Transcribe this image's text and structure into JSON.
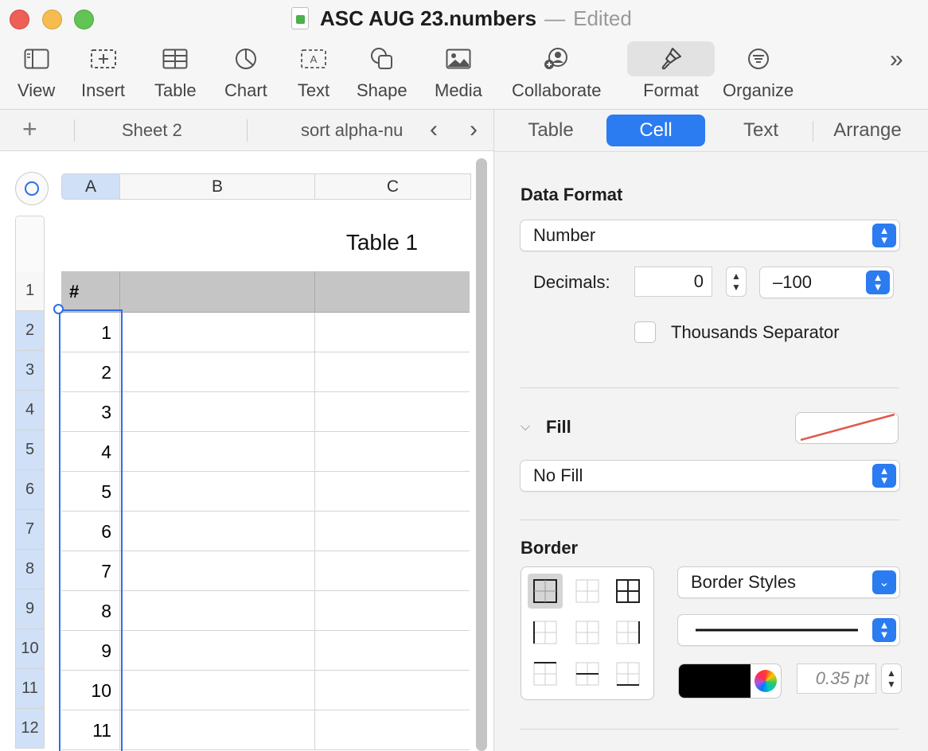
{
  "window": {
    "title": "ASC AUG 23.numbers",
    "separator": "—",
    "status": "Edited"
  },
  "toolbar": {
    "items": [
      {
        "label": "View",
        "icon": "sidebar-view-icon"
      },
      {
        "label": "Insert",
        "icon": "insert-plus-icon"
      },
      {
        "label": "Table",
        "icon": "table-grid-icon"
      },
      {
        "label": "Chart",
        "icon": "pie-chart-icon"
      },
      {
        "label": "Text",
        "icon": "text-box-icon"
      },
      {
        "label": "Shape",
        "icon": "shape-icon"
      },
      {
        "label": "Media",
        "icon": "photo-icon"
      },
      {
        "label": "Collaborate",
        "icon": "collaborate-icon"
      },
      {
        "label": "Format",
        "icon": "paintbrush-icon",
        "active": true
      },
      {
        "label": "Organize",
        "icon": "filter-lines-icon"
      }
    ],
    "more": "»"
  },
  "sheets": {
    "add": "+",
    "tabs": [
      "Sheet 2",
      "sort alpha-nu"
    ],
    "prev": "‹",
    "next": "›"
  },
  "spreadsheet": {
    "columns": [
      "A",
      "B",
      "C"
    ],
    "table_title": "Table 1",
    "header_cells": [
      "#",
      "",
      ""
    ],
    "row_numbers": [
      "1",
      "2",
      "3",
      "4",
      "5",
      "6",
      "7",
      "8",
      "9",
      "10",
      "11",
      "12"
    ],
    "values": [
      "1",
      "2",
      "3",
      "4",
      "5",
      "6",
      "7",
      "8",
      "9",
      "10",
      "11"
    ],
    "selection_color": "#2c6ee8",
    "header_fill": "#c5c5c5"
  },
  "inspector": {
    "tabs": [
      "Table",
      "Cell",
      "Text",
      "Arrange"
    ],
    "active_tab": "Cell",
    "data_format": {
      "title": "Data Format",
      "format": "Number",
      "decimals_label": "Decimals:",
      "decimals_value": "0",
      "negative_style": "–100",
      "thousands_label": "Thousands Separator",
      "thousands_checked": false
    },
    "fill": {
      "title": "Fill",
      "value": "No Fill"
    },
    "border": {
      "title": "Border",
      "styles": "Border Styles",
      "width": "0.35 pt",
      "color": "#000000"
    },
    "accent": "#2b7bf1"
  }
}
